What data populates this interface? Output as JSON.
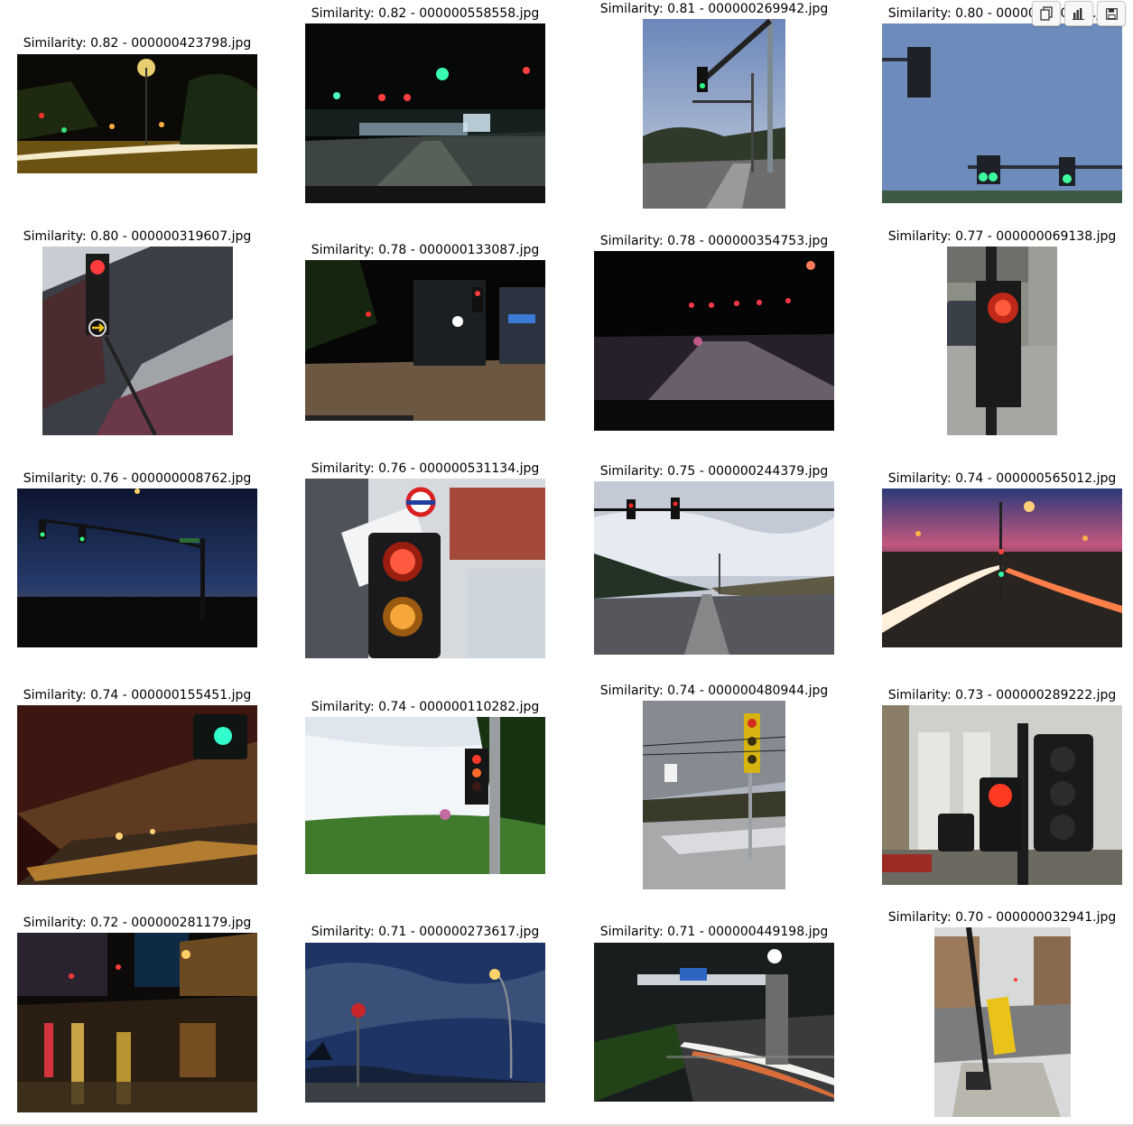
{
  "toolbar": {
    "icons": [
      "copy-icon",
      "chart-icon",
      "save-icon"
    ]
  },
  "results": [
    {
      "caption": "Similarity: 0.82 - 000000423798.jpg",
      "scene": "night-street-streaks"
    },
    {
      "caption": "Similarity: 0.82 - 000000558558.jpg",
      "scene": "night-blurred-lights"
    },
    {
      "caption": "Similarity: 0.81 - 000000269942.jpg",
      "scene": "day-overhead-signal"
    },
    {
      "caption": "Similarity: 0.80 - 000000250380.jpg",
      "scene": "blue-sky-green-lights"
    },
    {
      "caption": "Similarity: 0.80 - 000000319607.jpg",
      "scene": "tilted-building-signal"
    },
    {
      "caption": "Similarity: 0.78 - 000000133087.jpg",
      "scene": "night-town-junction"
    },
    {
      "caption": "Similarity: 0.78 - 000000354753.jpg",
      "scene": "night-windshield-red"
    },
    {
      "caption": "Similarity: 0.77 - 000000069138.jpg",
      "scene": "pedestrian-red-man"
    },
    {
      "caption": "Similarity: 0.76 - 000000008762.jpg",
      "scene": "dusk-silhouette-signal"
    },
    {
      "caption": "Similarity: 0.76 - 000000531134.jpg",
      "scene": "closeup-red-amber"
    },
    {
      "caption": "Similarity: 0.75 - 000000244379.jpg",
      "scene": "cloudy-highway-red"
    },
    {
      "caption": "Similarity: 0.74 - 000000565012.jpg",
      "scene": "sunset-highway-streaks"
    },
    {
      "caption": "Similarity: 0.74 - 000000155451.jpg",
      "scene": "underpass-green"
    },
    {
      "caption": "Similarity: 0.74 - 000000110282.jpg",
      "scene": "grass-pole-signal"
    },
    {
      "caption": "Similarity: 0.74 - 000000480944.jpg",
      "scene": "suburban-yellow-signal"
    },
    {
      "caption": "Similarity: 0.73 - 000000289222.jpg",
      "scene": "building-pedestrian-signal"
    },
    {
      "caption": "Similarity: 0.72 - 000000281179.jpg",
      "scene": "wet-night-street"
    },
    {
      "caption": "Similarity: 0.71 - 000000273617.jpg",
      "scene": "twilight-stop-sign"
    },
    {
      "caption": "Similarity: 0.71 - 000000449198.jpg",
      "scene": "overpass-night-streaks"
    },
    {
      "caption": "Similarity: 0.70 - 000000032941.jpg",
      "scene": "street-yellow-bollard"
    }
  ]
}
